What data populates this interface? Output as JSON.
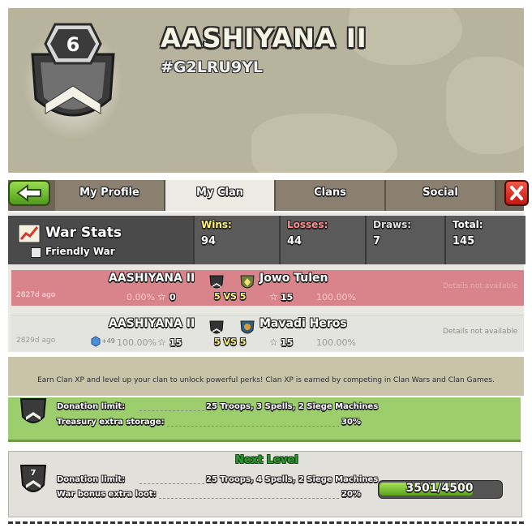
{
  "header": {
    "clan_level": "6",
    "clan_name": "AASHIYANA II",
    "clan_tag": "#G2LRU9YL"
  },
  "tabs": [
    {
      "label": "My Profile"
    },
    {
      "label": "My Clan"
    },
    {
      "label": "Clans"
    },
    {
      "label": "Social"
    }
  ],
  "war_stats": {
    "title": "War Stats",
    "friendly_war_label": "Friendly War",
    "wins": {
      "label": "Wins:",
      "value": "94"
    },
    "losses": {
      "label": "Losses:",
      "value": "44"
    },
    "draws": {
      "label": "Draws:",
      "value": "7"
    },
    "total": {
      "label": "Total:",
      "value": "145"
    }
  },
  "wars": [
    {
      "age": "2827d ago",
      "clan_name": "AASHIYANA II",
      "opponent_name": "Jowo Tulen",
      "clan_pct": "0.00%",
      "clan_stars": "0",
      "vs_text": "5 VS 5",
      "opp_stars": "15",
      "opp_pct": "100.00%",
      "details": "Details not available",
      "xp": ""
    },
    {
      "age": "2829d ago",
      "clan_name": "AASHIYANA II",
      "opponent_name": "Mavadi Heros",
      "clan_pct": "100.00%",
      "clan_stars": "15",
      "vs_text": "5 VS 5",
      "opp_stars": "15",
      "opp_pct": "100.00%",
      "details": "Details not available",
      "xp": "+49"
    }
  ],
  "xp_info": {
    "text": "Earn Clan XP and level up your clan to unlock powerful perks! Clan XP is earned by competing in Clan Wars and Clan Games."
  },
  "current_level": {
    "level": "6",
    "perks": [
      {
        "label": "Donation limit:",
        "value": "25 Troops, 3 Spells, 2 Siege Machines"
      },
      {
        "label": "Treasury extra storage:",
        "value": "30%"
      }
    ]
  },
  "next_level": {
    "title": "Next Level",
    "level": "7",
    "perks": [
      {
        "label": "Donation limit:",
        "value": "25 Troops, 4 Spells, 2 Siege Machines"
      },
      {
        "label": "War bonus extra loot:",
        "value": "20%"
      }
    ],
    "xp_progress": "3501/4500",
    "xp_fraction": 0.778
  },
  "colors": {
    "win_row": "#d8848a",
    "neutral_row": "#e3e3df",
    "next_level_green": "#2f9a2f",
    "loss_label": "#ff8c8c",
    "win_label": "#fff27a"
  }
}
